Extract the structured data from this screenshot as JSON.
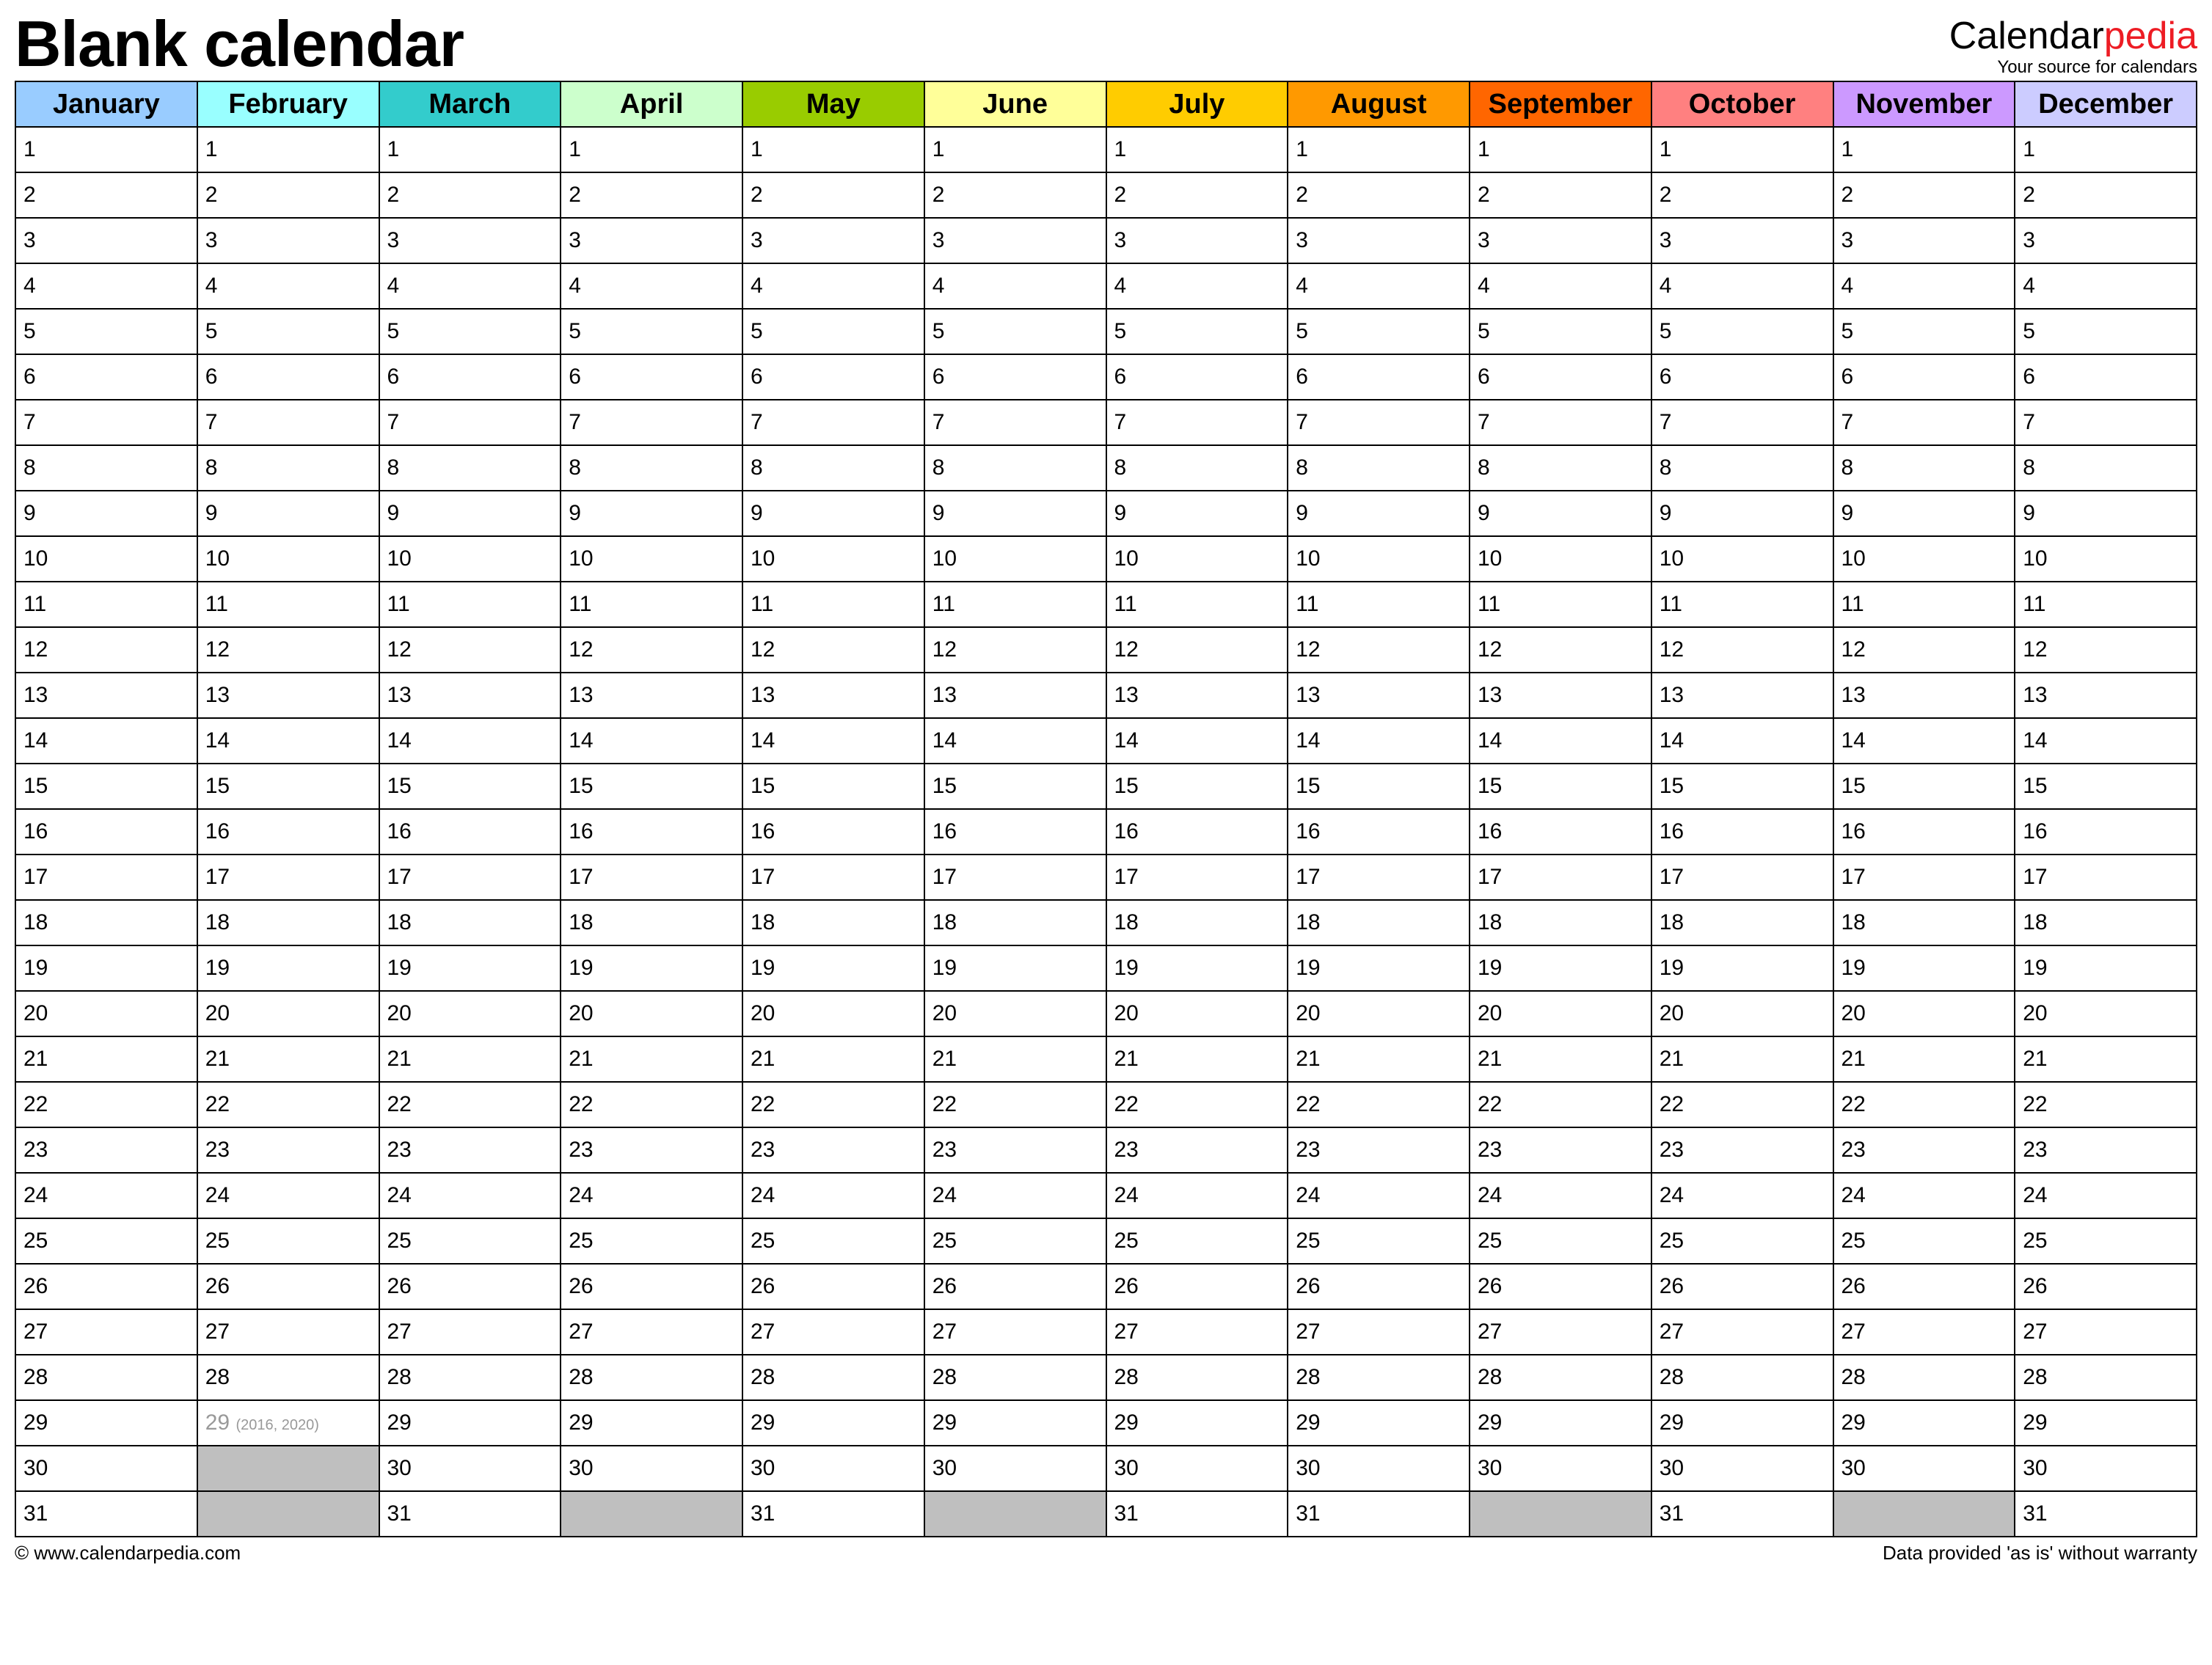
{
  "header": {
    "title": "Blank calendar",
    "brand_part1": "Calendar",
    "brand_part2": "pedia",
    "brand_tagline": "Your source for calendars"
  },
  "months": [
    {
      "name": "January",
      "color": "#99ccff",
      "days": 31
    },
    {
      "name": "February",
      "color": "#99ffff",
      "days": 29,
      "leap_day": 29,
      "leap_note": "(2016, 2020)"
    },
    {
      "name": "March",
      "color": "#33cccc",
      "days": 31
    },
    {
      "name": "April",
      "color": "#ccffcc",
      "days": 30
    },
    {
      "name": "May",
      "color": "#99cc00",
      "days": 31
    },
    {
      "name": "June",
      "color": "#ffff99",
      "days": 30
    },
    {
      "name": "July",
      "color": "#ffcc00",
      "days": 31
    },
    {
      "name": "August",
      "color": "#ff9900",
      "days": 31
    },
    {
      "name": "September",
      "color": "#ff6600",
      "days": 30
    },
    {
      "name": "October",
      "color": "#ff8080",
      "days": 31
    },
    {
      "name": "November",
      "color": "#cc99ff",
      "days": 30
    },
    {
      "name": "December",
      "color": "#ccccff",
      "days": 31
    }
  ],
  "max_rows": 31,
  "footer": {
    "left": "© www.calendarpedia.com",
    "right": "Data provided 'as is' without warranty"
  }
}
